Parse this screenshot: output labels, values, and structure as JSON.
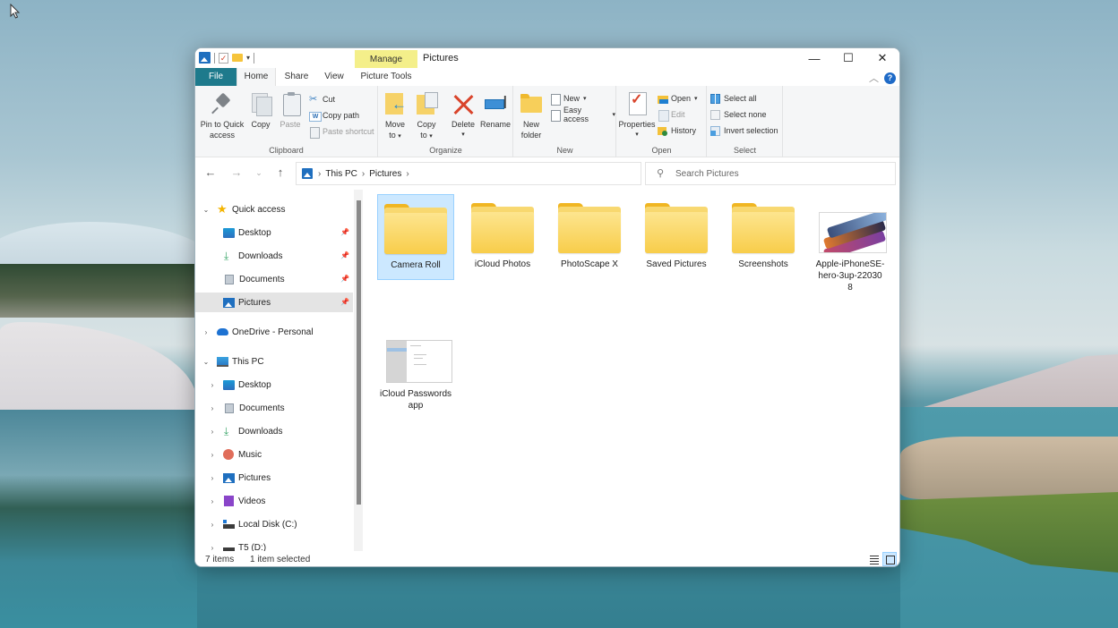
{
  "window": {
    "title": "Pictures",
    "contextual_tab_group": "Manage",
    "controls": {
      "minimize": "—",
      "maximize": "☐",
      "close": "✕"
    }
  },
  "ribbon": {
    "tabs": [
      {
        "label": "File"
      },
      {
        "label": "Home"
      },
      {
        "label": "Share"
      },
      {
        "label": "View"
      },
      {
        "label": "Picture Tools"
      }
    ],
    "active_tab": "Home",
    "clipboard": {
      "label": "Clipboard",
      "pin": "Pin to Quick access",
      "pin_line1": "Pin to Quick",
      "pin_line2": "access",
      "copy": "Copy",
      "paste": "Paste",
      "cut": "Cut",
      "copy_path": "Copy path",
      "paste_shortcut": "Paste shortcut"
    },
    "organize": {
      "label": "Organize",
      "move_to_1": "Move",
      "move_to_2": "to",
      "copy_to_1": "Copy",
      "copy_to_2": "to",
      "delete": "Delete",
      "rename": "Rename"
    },
    "new": {
      "label": "New",
      "new_folder_1": "New",
      "new_folder_2": "folder",
      "new_item": "New",
      "easy_access": "Easy access"
    },
    "open": {
      "label": "Open",
      "properties": "Properties",
      "open": "Open",
      "edit": "Edit",
      "history": "History"
    },
    "select": {
      "label": "Select",
      "select_all": "Select all",
      "select_none": "Select none",
      "invert_selection": "Invert selection"
    }
  },
  "address_bar": {
    "breadcrumbs": [
      "This PC",
      "Pictures"
    ],
    "search_placeholder": "Search Pictures"
  },
  "nav_pane": {
    "items": [
      {
        "label": "Quick access",
        "icon": "star-icon",
        "expanded": true
      },
      {
        "label": "Desktop",
        "icon": "desktop-icon",
        "pinned": true
      },
      {
        "label": "Downloads",
        "icon": "downloads-icon",
        "pinned": true
      },
      {
        "label": "Documents",
        "icon": "documents-icon",
        "pinned": true
      },
      {
        "label": "Pictures",
        "icon": "pictures-icon",
        "pinned": true,
        "selected": true
      },
      {
        "label": "OneDrive - Personal",
        "icon": "onedrive-icon",
        "expanded": false
      },
      {
        "label": "This PC",
        "icon": "this-pc-icon",
        "expanded": true
      },
      {
        "label": "Desktop",
        "icon": "desktop-icon"
      },
      {
        "label": "Documents",
        "icon": "documents-icon"
      },
      {
        "label": "Downloads",
        "icon": "downloads-icon"
      },
      {
        "label": "Music",
        "icon": "music-icon"
      },
      {
        "label": "Pictures",
        "icon": "pictures-icon"
      },
      {
        "label": "Videos",
        "icon": "videos-icon"
      },
      {
        "label": "Local Disk (C:)",
        "icon": "local-disk-icon"
      },
      {
        "label": "T5 (D:)",
        "icon": "drive-icon"
      }
    ]
  },
  "files": [
    {
      "name": "Camera Roll",
      "type": "folder",
      "selected": true
    },
    {
      "name": "iCloud Photos",
      "type": "folder"
    },
    {
      "name": "PhotoScape X",
      "type": "folder"
    },
    {
      "name": "Saved Pictures",
      "type": "folder"
    },
    {
      "name": "Screenshots",
      "type": "folder"
    },
    {
      "name": "Apple-iPhoneSE-hero-3up-220308",
      "name_lines": [
        "Apple-iPhoneSE-",
        "hero-3up-22030",
        "8"
      ],
      "type": "image"
    },
    {
      "name": "iCloud Passwords app",
      "name_lines": [
        "iCloud Passwords",
        "app"
      ],
      "type": "image"
    }
  ],
  "status_bar": {
    "item_count": "7 items",
    "selection": "1 item selected"
  },
  "colors": {
    "file_tab": "#1e7a8c",
    "manage_tab": "#f4ef8a",
    "selection": "#cce8ff",
    "folder": "#f8cd4a"
  }
}
